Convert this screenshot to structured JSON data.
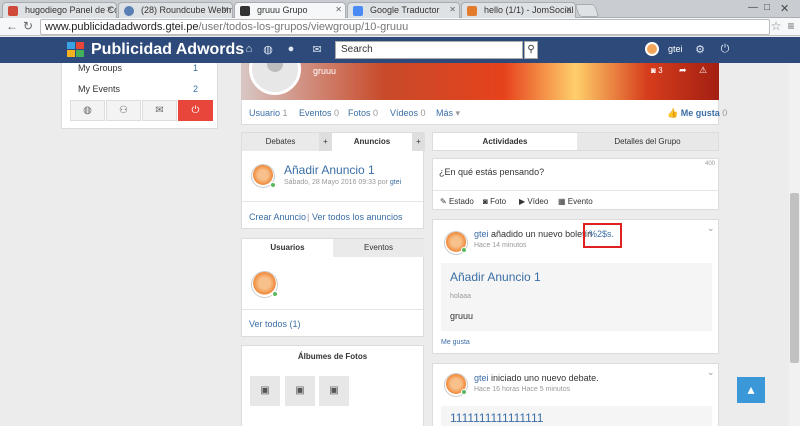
{
  "browser": {
    "tabs": [
      {
        "label": "hugodiego Panel de Con",
        "color": "#d04a3a"
      },
      {
        "label": "(28) Roundcube Webmail",
        "color": "#5a7fb5"
      },
      {
        "label": "gruuu Grupo",
        "color": "#333333"
      },
      {
        "label": "Google Traductor",
        "color": "#4a8af4"
      },
      {
        "label": "hello (1/1) - JomSocial Fo",
        "color": "#e27b2c"
      }
    ],
    "url_host": "www.publicidadadwords.gtei.pe",
    "url_path": "/user/todos-los-grupos/viewgroup/10-gruuu"
  },
  "nav": {
    "brand": "Publicidad Adwords",
    "search_placeholder": "Search",
    "username": "gtei"
  },
  "sidebar": {
    "groups_label": "My Groups",
    "groups_count": "1",
    "events_label": "My Events",
    "events_count": "2"
  },
  "group": {
    "name": "gruuu",
    "photo_count": "3",
    "stats": [
      {
        "label": "Usuario",
        "count": "1"
      },
      {
        "label": "Eventos",
        "count": "0"
      },
      {
        "label": "Fotos",
        "count": "0"
      },
      {
        "label": "Vídeos",
        "count": "0"
      }
    ],
    "more": "Más",
    "like": "Me gusta",
    "like_count": "0"
  },
  "left_tabs": {
    "debates": "Debates",
    "anuncios": "Anuncios"
  },
  "announcement": {
    "title": "Añadir Anuncio 1",
    "date": "Sábado, 28 Mayo 2016 09:33 por",
    "author": "gtei",
    "create": "Crear Anuncio",
    "view_all": "Ver todos los anuncios"
  },
  "members_tabs": {
    "users": "Usuarios",
    "events": "Eventos"
  },
  "members": {
    "view_all": "Ver todos (1)"
  },
  "albums": {
    "title": "Álbumes de Fotos"
  },
  "activity_tabs": {
    "activities": "Actividades",
    "details": "Detalles del Grupo"
  },
  "composer": {
    "placeholder": "¿En qué estás pensando?",
    "char_count": "400",
    "actions": [
      "Estado",
      "Foto",
      "Vídeo",
      "Evento"
    ]
  },
  "feed": [
    {
      "user": "gtei",
      "text": "añadido un nuevo boletín",
      "highlight": "%2$s.",
      "time": "Hace 14 minutos",
      "title": "Añadir Anuncio 1",
      "subtitle": "holaaa",
      "body": "gruuu",
      "like": "Me gusta"
    },
    {
      "user": "gtei",
      "text": "iniciado uno nuevo debate.",
      "time": "Hace 16 horas Hace 5 minutos",
      "title": "1111111111111111"
    }
  ],
  "colors": {
    "nav": "#2d4a7a",
    "accent": "#3b6ea5",
    "power": "#e8463a",
    "highlight_box": "#e02020"
  }
}
